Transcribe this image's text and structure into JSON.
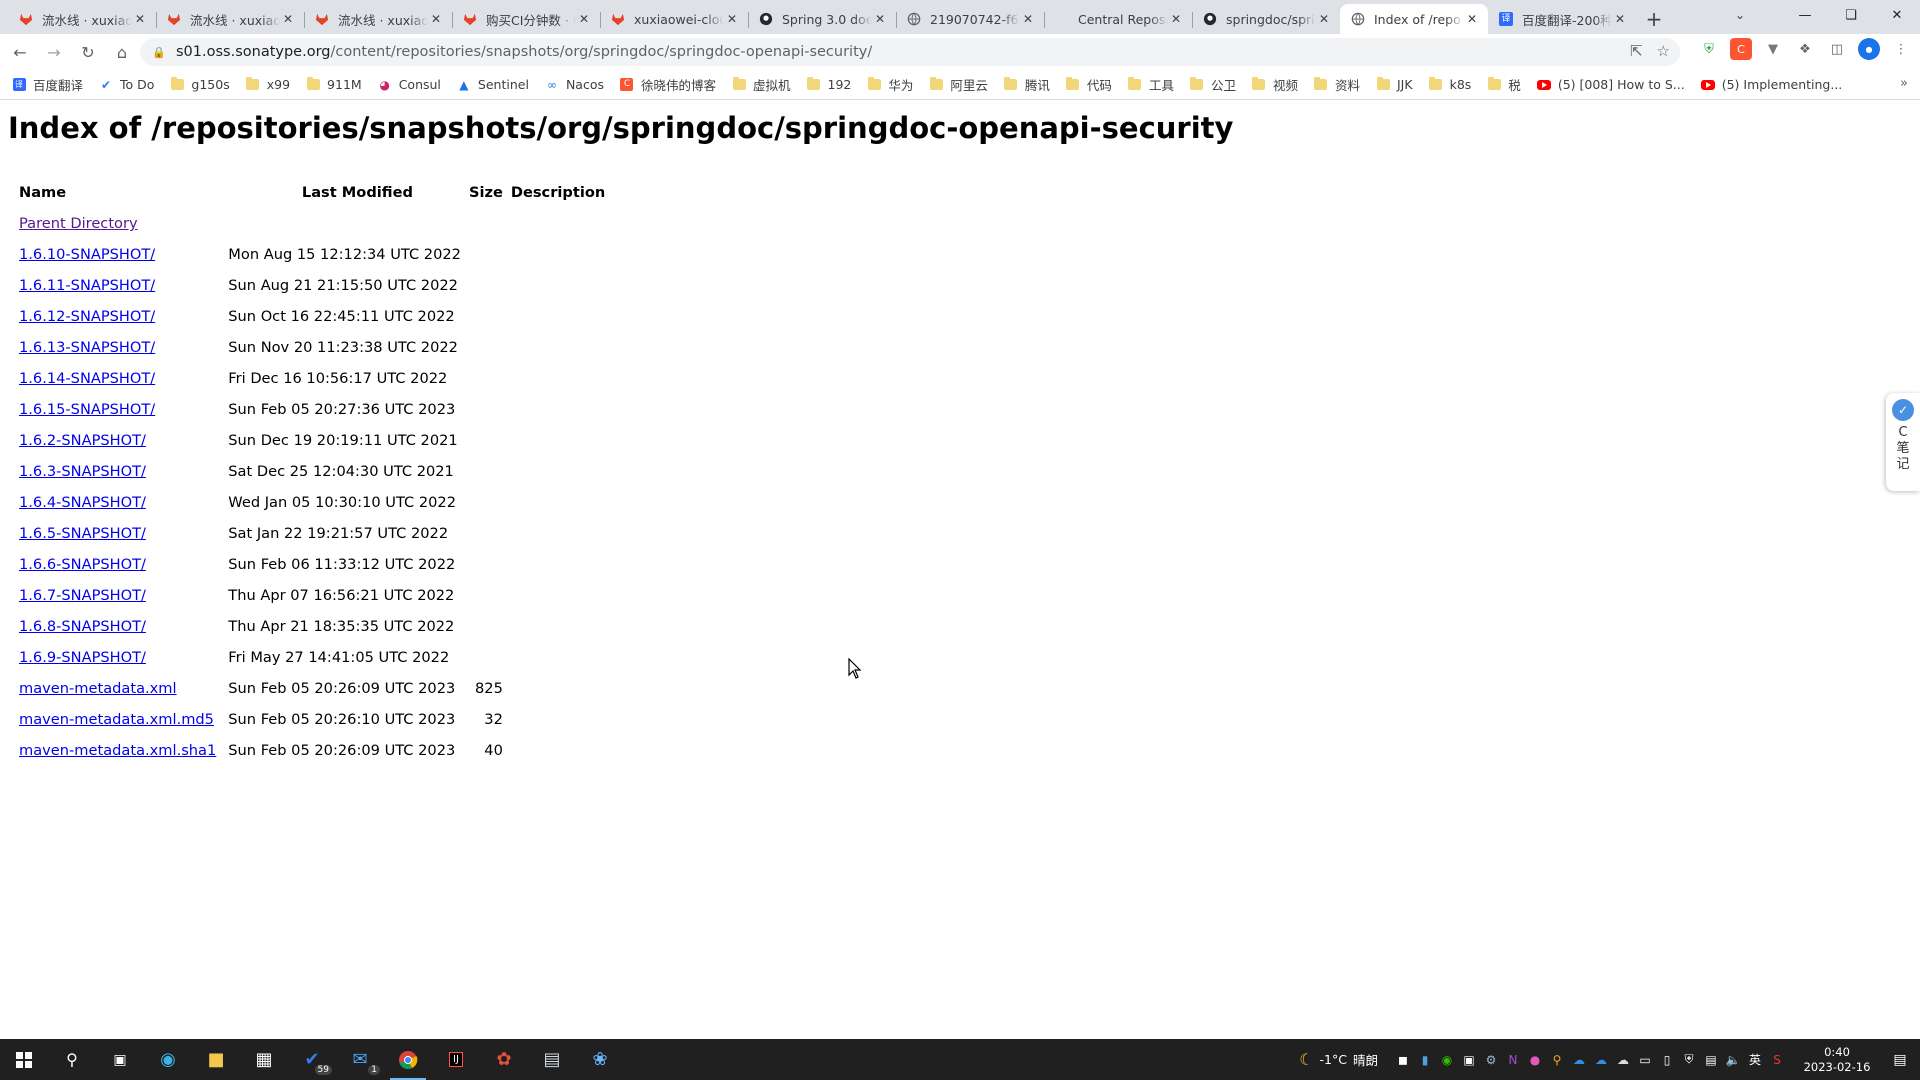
{
  "browser": {
    "tabs": [
      {
        "title": "流水线 · xuxiao",
        "icon": "gitlab-icon",
        "color": "#e24329"
      },
      {
        "title": "流水线 · xuxiao",
        "icon": "gitlab-icon",
        "color": "#e24329"
      },
      {
        "title": "流水线 · xuxiao",
        "icon": "gitlab-icon",
        "color": "#e24329"
      },
      {
        "title": "购买CI分钟数 · G",
        "icon": "gitlab-icon",
        "color": "#e24329"
      },
      {
        "title": "xuxiaowei-clou",
        "icon": "gitlab-icon",
        "color": "#e24329"
      },
      {
        "title": "Spring 3.0 doe",
        "icon": "github-icon",
        "color": "#24292f"
      },
      {
        "title": "219070742-f6f",
        "icon": "globe-icon",
        "color": "#5f6368"
      },
      {
        "title": "Central Reposi",
        "icon": "blank-icon",
        "color": "#ffffff"
      },
      {
        "title": "springdoc/spri",
        "icon": "github-icon",
        "color": "#24292f"
      },
      {
        "title": "Index of /repo",
        "icon": "globe-icon",
        "color": "#5f6368",
        "active": true
      },
      {
        "title": "百度翻译-200种",
        "icon": "baidu-translate-icon",
        "color": "#2f6bff"
      }
    ],
    "address": {
      "host": "s01.oss.sonatype.org",
      "path": "/content/repositories/snapshots/org/springdoc/springdoc-openapi-security/"
    },
    "bookmarks": [
      {
        "label": "百度翻译",
        "icon": "baidu-translate-icon",
        "kind": "site"
      },
      {
        "label": "To Do",
        "icon": "check-icon",
        "kind": "site"
      },
      {
        "label": "g150s",
        "kind": "folder"
      },
      {
        "label": "x99",
        "kind": "folder"
      },
      {
        "label": "911M",
        "kind": "folder"
      },
      {
        "label": "Consul",
        "icon": "consul-icon",
        "kind": "site"
      },
      {
        "label": "Sentinel",
        "icon": "sentinel-icon",
        "kind": "site"
      },
      {
        "label": "Nacos",
        "icon": "nacos-icon",
        "kind": "site"
      },
      {
        "label": "徐晓伟的博客",
        "icon": "csdn-icon",
        "kind": "site"
      },
      {
        "label": "虚拟机",
        "kind": "folder"
      },
      {
        "label": "192",
        "kind": "folder"
      },
      {
        "label": "华为",
        "kind": "folder"
      },
      {
        "label": "阿里云",
        "kind": "folder"
      },
      {
        "label": "腾讯",
        "kind": "folder"
      },
      {
        "label": "代码",
        "kind": "folder"
      },
      {
        "label": "工具",
        "kind": "folder"
      },
      {
        "label": "公卫",
        "kind": "folder"
      },
      {
        "label": "视频",
        "kind": "folder"
      },
      {
        "label": "资料",
        "kind": "folder"
      },
      {
        "label": "JJK",
        "kind": "folder"
      },
      {
        "label": "k8s",
        "kind": "folder"
      },
      {
        "label": "税",
        "kind": "folder"
      },
      {
        "label": "(5) [008] How to S...",
        "icon": "youtube-icon",
        "kind": "site"
      },
      {
        "label": "(5) Implementing...",
        "icon": "youtube-icon",
        "kind": "site"
      }
    ],
    "bookmarks_more": "»"
  },
  "page": {
    "title": "Index of /repositories/snapshots/org/springdoc/springdoc-openapi-security",
    "columns": {
      "name": "Name",
      "modified": "Last Modified",
      "size": "Size",
      "description": "Description"
    },
    "parent_label": "Parent Directory",
    "rows": [
      {
        "name": "1.6.10-SNAPSHOT/",
        "modified": "Mon Aug 15 12:12:34 UTC 2022",
        "size": "",
        "description": ""
      },
      {
        "name": "1.6.11-SNAPSHOT/",
        "modified": "Sun Aug 21 21:15:50 UTC 2022",
        "size": "",
        "description": ""
      },
      {
        "name": "1.6.12-SNAPSHOT/",
        "modified": "Sun Oct 16 22:45:11 UTC 2022",
        "size": "",
        "description": ""
      },
      {
        "name": "1.6.13-SNAPSHOT/",
        "modified": "Sun Nov 20 11:23:38 UTC 2022",
        "size": "",
        "description": ""
      },
      {
        "name": "1.6.14-SNAPSHOT/",
        "modified": "Fri Dec 16 10:56:17 UTC 2022",
        "size": "",
        "description": ""
      },
      {
        "name": "1.6.15-SNAPSHOT/",
        "modified": "Sun Feb 05 20:27:36 UTC 2023",
        "size": "",
        "description": ""
      },
      {
        "name": "1.6.2-SNAPSHOT/",
        "modified": "Sun Dec 19 20:19:11 UTC 2021",
        "size": "",
        "description": ""
      },
      {
        "name": "1.6.3-SNAPSHOT/",
        "modified": "Sat Dec 25 12:04:30 UTC 2021",
        "size": "",
        "description": ""
      },
      {
        "name": "1.6.4-SNAPSHOT/",
        "modified": "Wed Jan 05 10:30:10 UTC 2022",
        "size": "",
        "description": ""
      },
      {
        "name": "1.6.5-SNAPSHOT/",
        "modified": "Sat Jan 22 19:21:57 UTC 2022",
        "size": "",
        "description": ""
      },
      {
        "name": "1.6.6-SNAPSHOT/",
        "modified": "Sun Feb 06 11:33:12 UTC 2022",
        "size": "",
        "description": ""
      },
      {
        "name": "1.6.7-SNAPSHOT/",
        "modified": "Thu Apr 07 16:56:21 UTC 2022",
        "size": "",
        "description": ""
      },
      {
        "name": "1.6.8-SNAPSHOT/",
        "modified": "Thu Apr 21 18:35:35 UTC 2022",
        "size": "",
        "description": ""
      },
      {
        "name": "1.6.9-SNAPSHOT/",
        "modified": "Fri May 27 14:41:05 UTC 2022",
        "size": "",
        "description": ""
      },
      {
        "name": "maven-metadata.xml",
        "modified": "Sun Feb 05 20:26:09 UTC 2023",
        "size": "825",
        "description": ""
      },
      {
        "name": "maven-metadata.xml.md5",
        "modified": "Sun Feb 05 20:26:10 UTC 2023",
        "size": "32",
        "description": ""
      },
      {
        "name": "maven-metadata.xml.sha1",
        "modified": "Sun Feb 05 20:26:09 UTC 2023",
        "size": "40",
        "description": ""
      }
    ],
    "side_widget": {
      "letter": "C",
      "text1": "笔",
      "text2": "记"
    }
  },
  "taskbar": {
    "badges": {
      "todo": "59",
      "mail": "1"
    },
    "weather": {
      "temp": "-1°C",
      "condition": "晴朗"
    },
    "ime": "英",
    "clock": {
      "time": "0:40",
      "date": "2023-02-16"
    }
  }
}
